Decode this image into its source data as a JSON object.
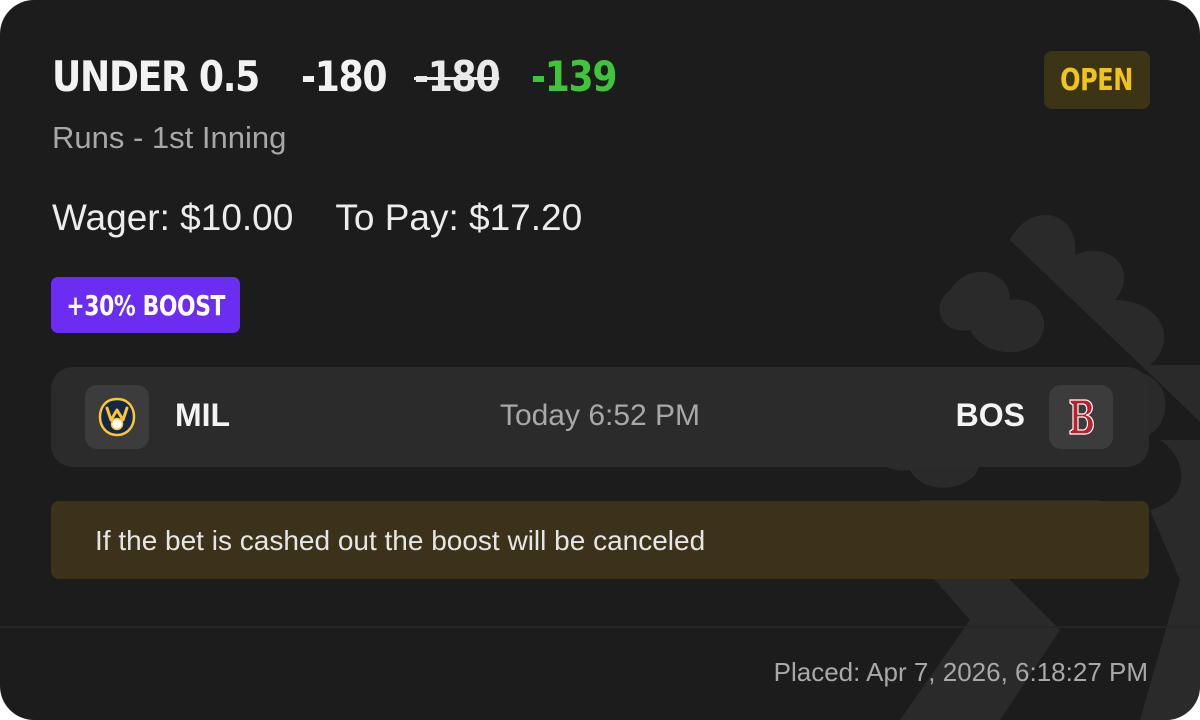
{
  "bet": {
    "market": "UNDER 0.5",
    "odds": "-180",
    "original_odds": "-180",
    "boosted_odds": "-139",
    "description": "Runs - 1st Inning",
    "status": "OPEN",
    "boost_label": "+30% BOOST",
    "wager_label": "Wager: $10.00",
    "to_pay_label": "To Pay: $17.20"
  },
  "game": {
    "home_team": "MIL",
    "away_team": "BOS",
    "time": "Today 6:52 PM",
    "home_logo_icon": "brewers-glove-logo-icon",
    "away_logo_icon": "red-sox-b-logo-icon"
  },
  "notice": "If the bet is cashed out the boost will be canceled",
  "footer": {
    "placed": "Placed: Apr 7, 2026, 6:18:27 PM"
  },
  "colors": {
    "card_background": "#1c1c1c",
    "boosted_odds": "#3fc53a",
    "status_text": "#f2c318",
    "status_background": "#3b3415",
    "boost_background": "#6b2df2",
    "notice_background": "#3b3219"
  }
}
